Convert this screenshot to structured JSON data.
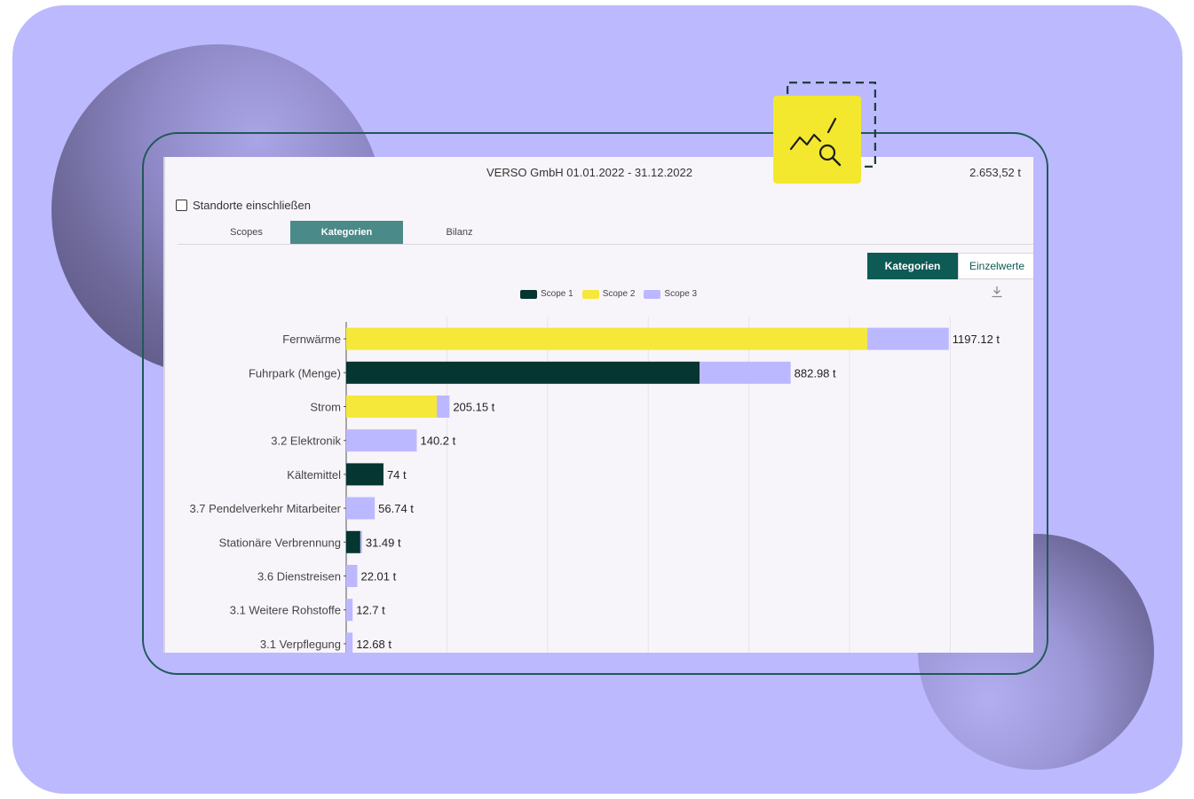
{
  "header": {
    "title": "VERSO GmbH 01.01.2022 - 31.12.2022",
    "total": "2.653,52 t"
  },
  "checkbox": {
    "label": "Standorte einschließen",
    "checked": false
  },
  "tabs": [
    {
      "label": "Scopes",
      "active": false
    },
    {
      "label": "Kategorien",
      "active": true
    },
    {
      "label": "Bilanz",
      "active": false
    }
  ],
  "toggle": {
    "on_label": "Kategorien",
    "off_label": "Einzelwerte"
  },
  "icons": {
    "download": "download-icon",
    "badge": "chart-search-icon"
  },
  "colors": {
    "scope1": "#053631",
    "scope2": "#f5e83a",
    "scope3": "#bcb8ff",
    "accent": "#0e5a55",
    "background": "#bcb9ff"
  },
  "chart_data": {
    "type": "bar",
    "orientation": "horizontal",
    "stacked": true,
    "legend_placement": "top-center",
    "grid": true,
    "xlim": [
      0,
      1400
    ],
    "series": [
      {
        "name": "Scope 1",
        "color": "#053631",
        "values": [
          0,
          702,
          0,
          0,
          74,
          0,
          28,
          0,
          0,
          0
        ]
      },
      {
        "name": "Scope 2",
        "color": "#f5e83a",
        "values": [
          1035,
          0,
          180,
          0,
          0,
          0,
          0,
          0,
          0,
          0
        ]
      },
      {
        "name": "Scope 3",
        "color": "#bcb8ff",
        "values": [
          162.12,
          180.98,
          25.15,
          140.2,
          0,
          56.74,
          3.49,
          22.01,
          12.7,
          12.68
        ]
      }
    ],
    "categories": [
      "Fernwärme",
      "Fuhrpark (Menge)",
      "Strom",
      "3.2 Elektronik",
      "Kältemittel",
      "3.7 Pendelverkehr Mitarbeiter",
      "Stationäre Verbrennung",
      "3.6 Dienstreisen",
      "3.1 Weitere Rohstoffe",
      "3.1 Verpflegung"
    ],
    "totals_labels": [
      "1197.12 t",
      "882.98 t",
      "205.15 t",
      "140.2 t",
      "74 t",
      "56.74 t",
      "31.49 t",
      "22.01 t",
      "12.7 t",
      "12.68 t"
    ]
  }
}
